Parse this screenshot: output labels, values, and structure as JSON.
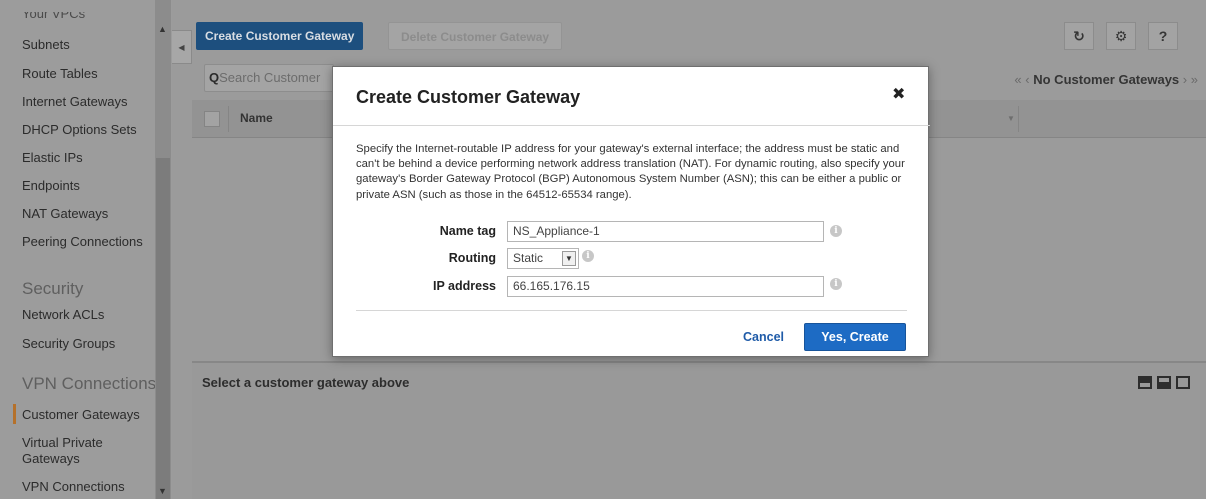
{
  "sidebar": {
    "truncated_top": "Your VPCs",
    "items": [
      {
        "label": "Subnets"
      },
      {
        "label": "Route Tables"
      },
      {
        "label": "Internet Gateways"
      },
      {
        "label": "DHCP Options Sets"
      },
      {
        "label": "Elastic IPs"
      },
      {
        "label": "Endpoints"
      },
      {
        "label": "NAT Gateways"
      },
      {
        "label": "Peering Connections"
      }
    ],
    "security_section": "Security",
    "security_items": [
      {
        "label": "Network ACLs"
      },
      {
        "label": "Security Groups"
      }
    ],
    "vpn_section": "VPN Connections",
    "vpn_items": [
      {
        "label": "Customer Gateways",
        "active": true
      },
      {
        "label": "Virtual Private Gateways"
      },
      {
        "label": "VPN Connections"
      }
    ]
  },
  "toolbar": {
    "create_label": "Create Customer Gateway",
    "delete_label": "Delete Customer Gateway",
    "refresh_icon": "refresh-icon",
    "settings_icon": "gear-icon",
    "help_icon": "help-icon"
  },
  "search": {
    "placeholder": "Search Customer"
  },
  "pager": {
    "text": "No Customer Gateways"
  },
  "table": {
    "columns": [
      "Name"
    ]
  },
  "detail": {
    "title": "Select a customer gateway above"
  },
  "modal": {
    "title": "Create Customer Gateway",
    "description": "Specify the Internet-routable IP address for your gateway's external interface; the address must be static and can't be behind a device performing network address translation (NAT). For dynamic routing, also specify your gateway's Border Gateway Protocol (BGP) Autonomous System Number (ASN); this can be either a public or private ASN (such as those in the 64512-65534 range).",
    "fields": {
      "name_tag_label": "Name tag",
      "name_tag_value": "NS_Appliance-1",
      "routing_label": "Routing",
      "routing_value": "Static",
      "ip_label": "IP address",
      "ip_value": "66.165.176.15"
    },
    "cancel_label": "Cancel",
    "submit_label": "Yes, Create"
  },
  "colors": {
    "primary_button": "#1d6bc4",
    "link": "#1f5ba8",
    "active_marker": "#b5712b"
  }
}
